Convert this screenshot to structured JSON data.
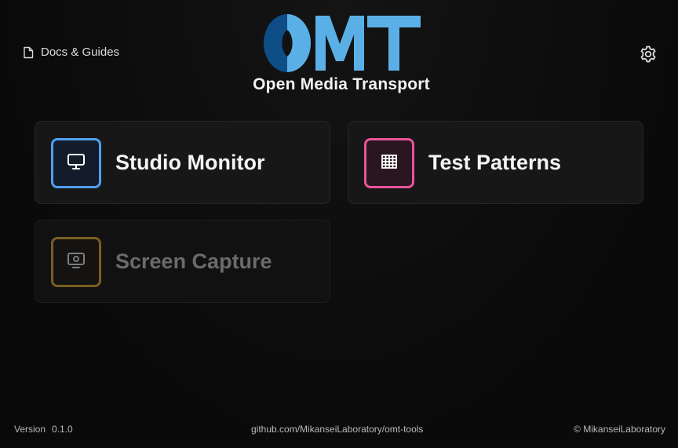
{
  "header": {
    "docs_label": "Docs & Guides",
    "logo_text": "OMT",
    "logo_caption": "Open Media Transport"
  },
  "colors": {
    "logo_dark_blue": "#0e4d86",
    "logo_light_blue": "#5ab0e6",
    "studio_accent": "#4f9ff0",
    "patterns_accent": "#e8549a",
    "capture_accent": "#7a5e21"
  },
  "icons": {
    "docs": "document-icon",
    "settings": "gear-icon",
    "studio": "monitor-icon",
    "patterns": "grid-icon",
    "capture": "screen-capture-icon"
  },
  "cards": [
    {
      "label": "Studio Monitor",
      "enabled": true
    },
    {
      "label": "Test Patterns",
      "enabled": true
    },
    {
      "label": "Screen Capture",
      "enabled": false
    }
  ],
  "footer": {
    "version_label": "Version",
    "version_value": "0.1.0",
    "repo": "github.com/MikanseiLaboratory/omt-tools",
    "copyright": "© MikanseiLaboratory"
  }
}
